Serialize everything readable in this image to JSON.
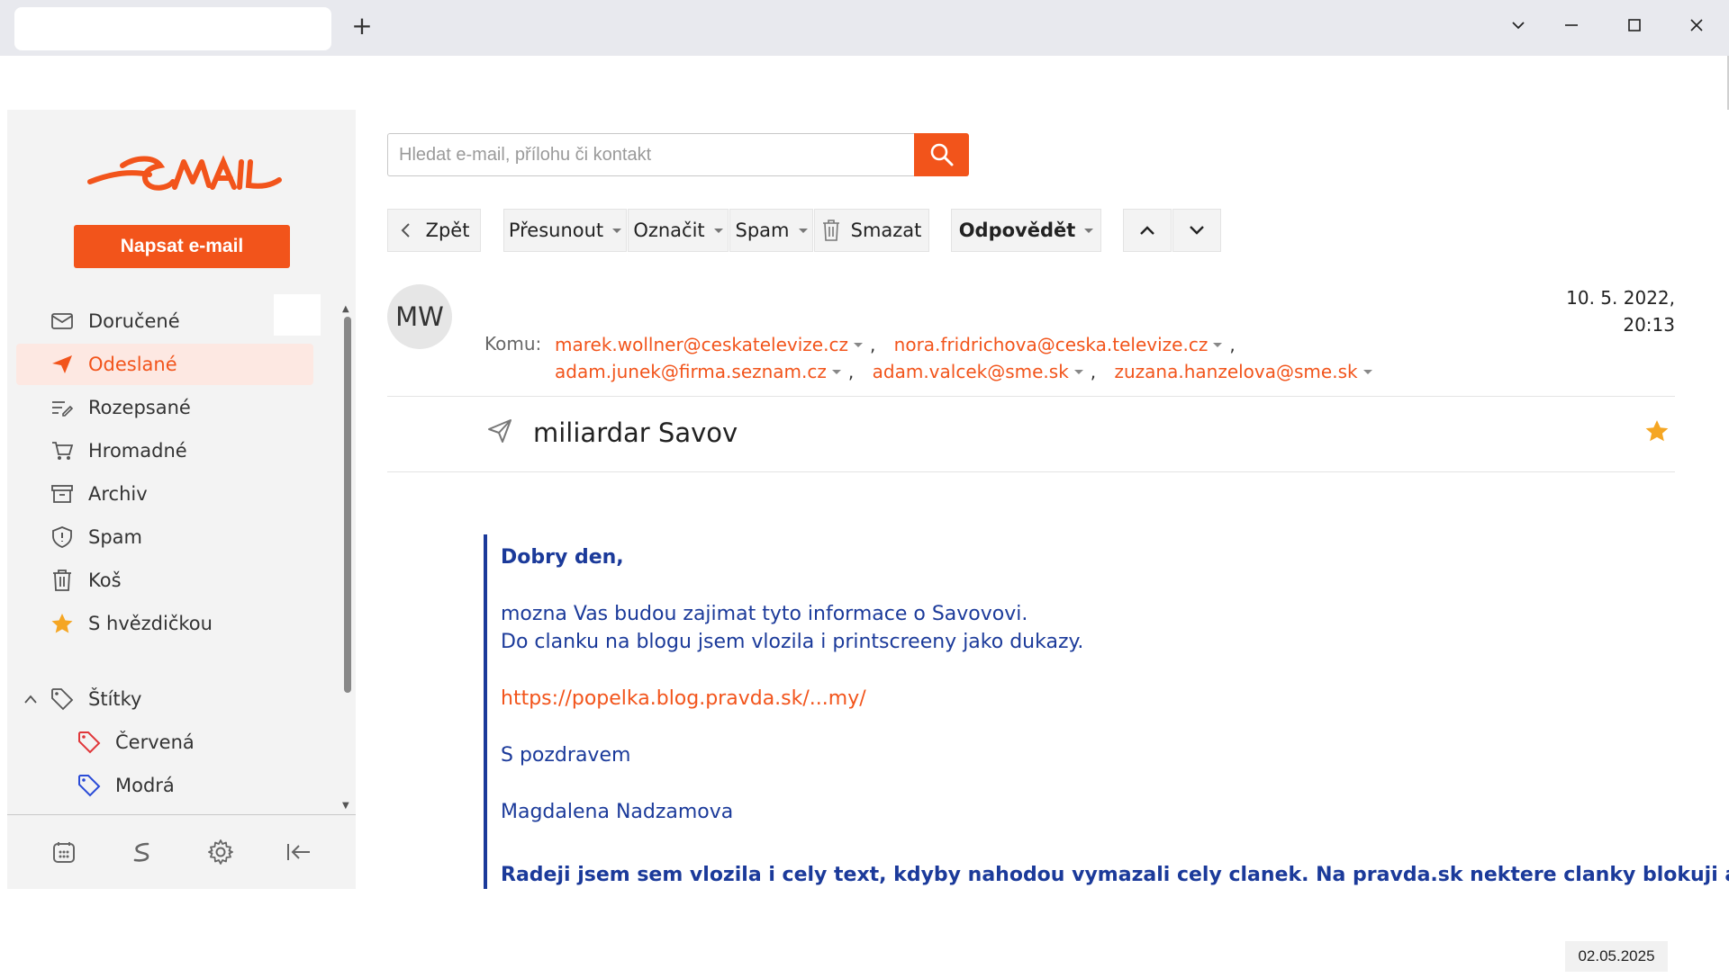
{
  "window": {
    "new_tab": "+",
    "controls": {
      "chevron": "⌄",
      "minimize": "—",
      "maximize": "☐",
      "close": "✕"
    }
  },
  "sidebar": {
    "compose_label": "Napsat e-mail",
    "folders": [
      {
        "label": "Doručené",
        "icon": "inbox-icon"
      },
      {
        "label": "Odeslané",
        "icon": "send-icon",
        "active": true
      },
      {
        "label": "Rozepsané",
        "icon": "drafts-icon"
      },
      {
        "label": "Hromadné",
        "icon": "cart-icon"
      },
      {
        "label": "Archiv",
        "icon": "archive-icon"
      },
      {
        "label": "Spam",
        "icon": "shield-icon"
      },
      {
        "label": "Koš",
        "icon": "trash-icon"
      },
      {
        "label": "S hvězdičkou",
        "icon": "star-icon"
      }
    ],
    "labels_section": "Štítky",
    "labels": [
      {
        "label": "Červená",
        "color": "#e0373a"
      },
      {
        "label": "Modrá",
        "color": "#2a4bd7"
      }
    ]
  },
  "search": {
    "placeholder": "Hledat e-mail, přílohu či kontakt"
  },
  "toolbar": {
    "back": "Zpět",
    "move": "Přesunout",
    "mark": "Označit",
    "spam": "Spam",
    "delete": "Smazat",
    "reply": "Odpovědět"
  },
  "message": {
    "avatar": "MW",
    "date": "10. 5. 2022,",
    "time": "20:13",
    "to_label": "Komu:",
    "recipients": [
      "marek.wollner@ceskatelevize.cz",
      "nora.fridrichova@ceska.televize.cz",
      "adam.junek@firma.seznam.cz",
      "adam.valcek@sme.sk",
      "zuzana.hanzelova@sme.sk"
    ],
    "subject": "miliardar Savov",
    "starred": true,
    "body": {
      "greeting": "Dobry den,",
      "line1": "mozna Vas budou zajimat tyto informace o Savovovi.",
      "line2": "Do clanku na blogu jsem vlozila i printscreeny jako dukazy.",
      "link": "https://popelka.blog.pravda.sk/...my/",
      "closing": "S pozdravem",
      "signature": "Magdalena Nadzamova",
      "last_line": "Radeji jsem sem vlozila i cely text, kdyby nahodou vymazali cely clanek. Na pravda.sk nektere clanky blokuji a"
    }
  },
  "taskbar": {
    "date": "02.05.2025"
  },
  "colors": {
    "accent": "#f2541b",
    "body_text": "#1b3a9a"
  }
}
